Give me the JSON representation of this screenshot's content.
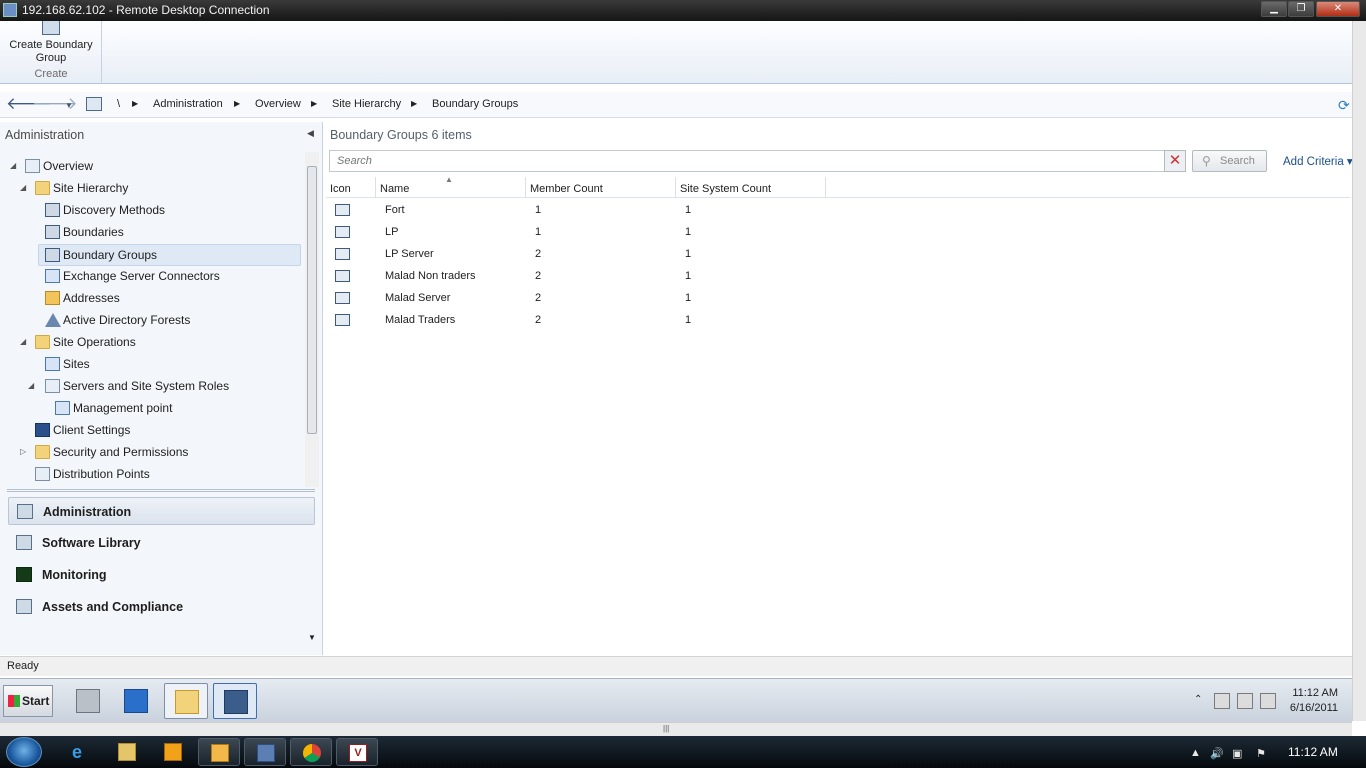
{
  "rdc": {
    "title": "192.168.62.102 - Remote Desktop Connection",
    "window_buttons": {
      "minimize": "▁",
      "restore": "❐",
      "close": "✕"
    }
  },
  "ribbon": {
    "create_button": "Create Boundary Group",
    "group_label": "Create"
  },
  "address_bar": {
    "back_icon": "arrow-left",
    "forward_icon": "arrow-right",
    "root": "\\",
    "crumbs": [
      "Administration",
      "Overview",
      "Site Hierarchy",
      "Boundary Groups"
    ]
  },
  "nav": {
    "header": "Administration",
    "tree": [
      {
        "label": "Overview",
        "icon": "tool-icon"
      },
      {
        "label": "Site Hierarchy",
        "icon": "folder-icon"
      },
      {
        "label": "Discovery Methods",
        "icon": "network-icon"
      },
      {
        "label": "Boundaries",
        "icon": "network-icon"
      },
      {
        "label": "Boundary Groups",
        "icon": "network-icon",
        "selected": true
      },
      {
        "label": "Exchange Server Connectors",
        "icon": "grid-icon"
      },
      {
        "label": "Addresses",
        "icon": "book-icon"
      },
      {
        "label": "Active Directory Forests",
        "icon": "forest-icon"
      },
      {
        "label": "Site Operations",
        "icon": "folder-icon"
      },
      {
        "label": "Sites",
        "icon": "grid-icon"
      },
      {
        "label": "Servers and Site System Roles",
        "icon": "server-icon"
      },
      {
        "label": "Management point",
        "icon": "grid-icon"
      },
      {
        "label": "Client Settings",
        "icon": "monitor-icon"
      },
      {
        "label": "Security and Permissions",
        "icon": "folder-icon"
      },
      {
        "label": "Distribution Points",
        "icon": "server-icon"
      }
    ],
    "workspaces": [
      "Administration",
      "Software Library",
      "Monitoring",
      "Assets and Compliance"
    ]
  },
  "main": {
    "header": "Boundary Groups 6 items",
    "search": {
      "placeholder": "Search",
      "button": "Search",
      "add_criteria": "Add Criteria ▾"
    },
    "columns": [
      "Icon",
      "Name",
      "Member Count",
      "Site System Count"
    ],
    "rows": [
      {
        "name": "Fort",
        "member_count": "1",
        "site_system_count": "1"
      },
      {
        "name": "LP",
        "member_count": "1",
        "site_system_count": "1"
      },
      {
        "name": "LP Server",
        "member_count": "2",
        "site_system_count": "1"
      },
      {
        "name": "Malad Non traders",
        "member_count": "2",
        "site_system_count": "1"
      },
      {
        "name": "Malad Server",
        "member_count": "2",
        "site_system_count": "1"
      },
      {
        "name": "Malad Traders",
        "member_count": "2",
        "site_system_count": "1"
      }
    ]
  },
  "status": {
    "text": "Ready"
  },
  "remote_taskbar": {
    "start": "Start",
    "time": "11:12 AM",
    "date": "6/16/2011"
  },
  "local_taskbar": {
    "time": "11:12 AM",
    "apps": [
      "internet-explorer-icon",
      "explorer-icon",
      "media-player-icon",
      "outlook-icon",
      "remote-desktop-icon",
      "chrome-icon",
      "vmware-icon"
    ]
  }
}
